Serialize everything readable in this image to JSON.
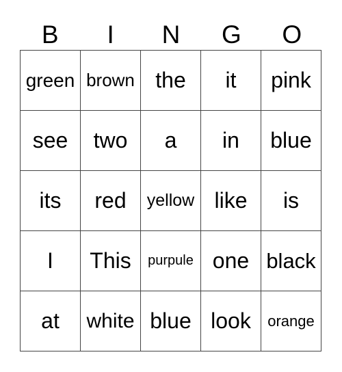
{
  "header": [
    "B",
    "I",
    "N",
    "G",
    "O"
  ],
  "rows": [
    [
      "green",
      "brown",
      "the",
      "it",
      "pink"
    ],
    [
      "see",
      "two",
      "a",
      "in",
      "blue"
    ],
    [
      "its",
      "red",
      "yellow",
      "like",
      "is"
    ],
    [
      "I",
      "This",
      "purpule",
      "one",
      "black"
    ],
    [
      "at",
      "white",
      "blue",
      "look",
      "orange"
    ]
  ]
}
